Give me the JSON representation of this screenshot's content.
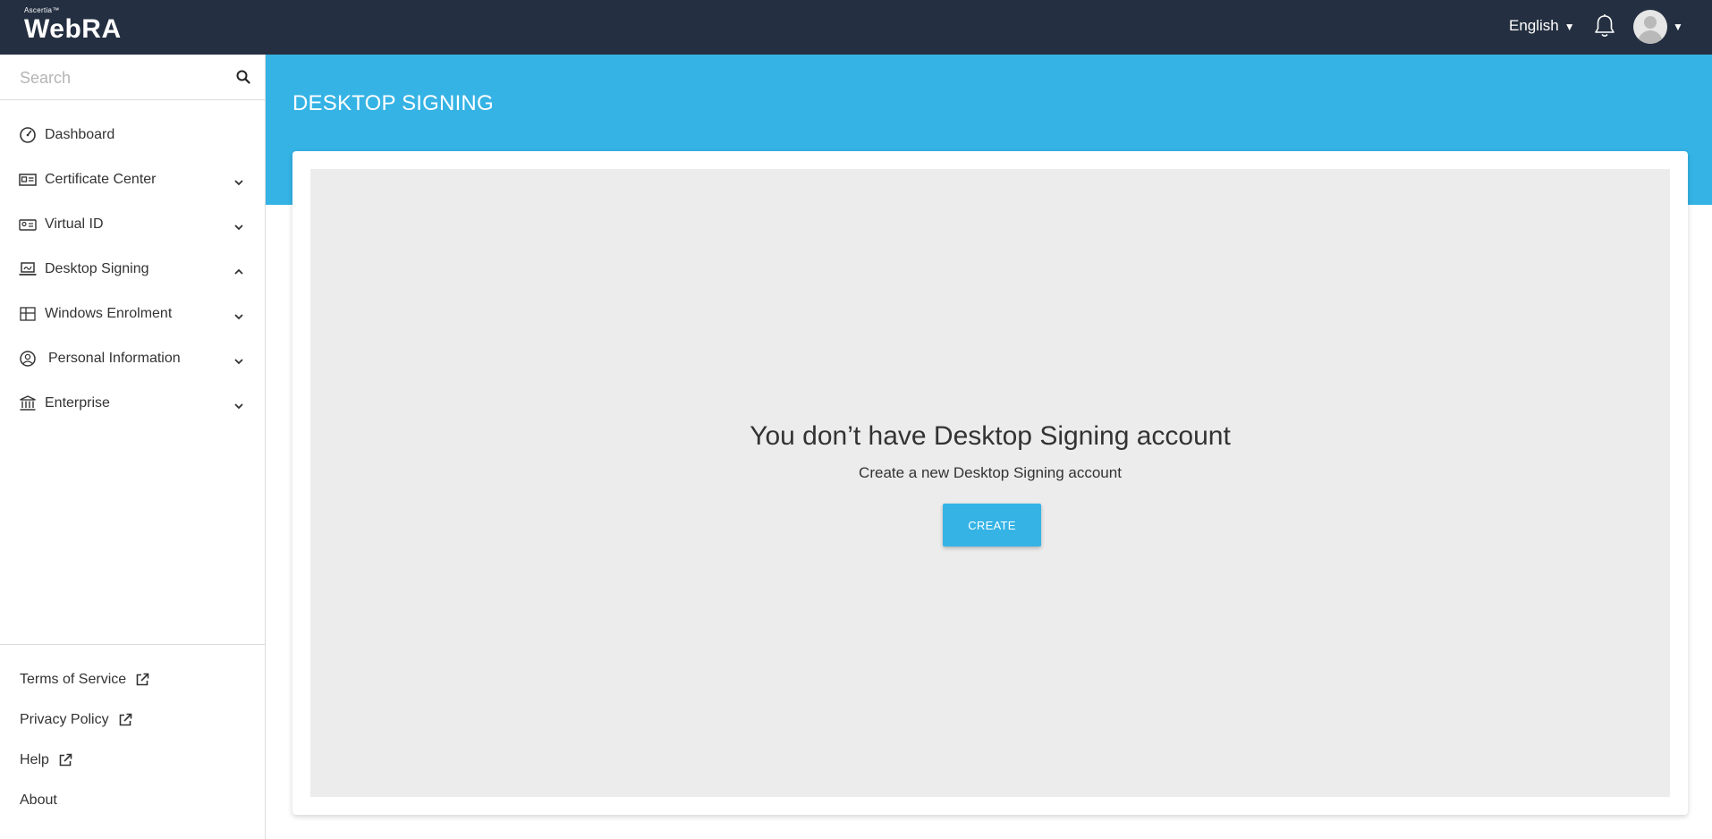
{
  "header": {
    "logo_small": "Ascertia™",
    "logo_big": "WebRA",
    "language": "English"
  },
  "sidebar": {
    "search_placeholder": "Search",
    "items": [
      {
        "label": "Dashboard",
        "icon": "dashboard-gauge-icon"
      },
      {
        "label": "Certificate Center",
        "icon": "certificate-card-icon"
      },
      {
        "label": "Virtual ID",
        "icon": "id-card-icon"
      },
      {
        "label": "Desktop Signing",
        "icon": "laptop-signing-icon"
      },
      {
        "label": "Windows Enrolment",
        "icon": "windows-icon"
      },
      {
        "label": "Personal Information",
        "icon": "user-circle-icon"
      },
      {
        "label": "Enterprise",
        "icon": "bank-building-icon"
      }
    ],
    "footer_links": [
      {
        "label": "Terms of Service",
        "external": true
      },
      {
        "label": "Privacy Policy",
        "external": true
      },
      {
        "label": "Help",
        "external": true
      },
      {
        "label": "About",
        "external": false
      }
    ]
  },
  "main": {
    "page_title": "DESKTOP SIGNING",
    "empty_title": "You don’t have Desktop Signing account",
    "empty_subtitle": "Create a new Desktop Signing account",
    "create_label": "CREATE"
  },
  "colors": {
    "topbar": "#242f41",
    "accent": "#35b3e5",
    "empty_bg": "#ececec"
  }
}
